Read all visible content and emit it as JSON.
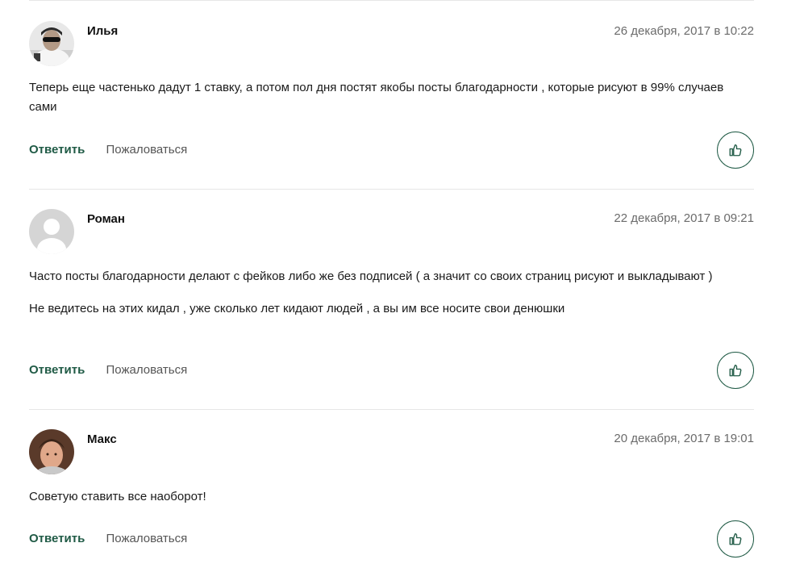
{
  "comments": [
    {
      "author": "Илья",
      "date": "26 декабря, 2017 в 10:22",
      "paragraphs": [
        "Теперь еще частенько дадут 1 ставку, а потом пол дня постят якобы посты благодарности , которые рисуют в 99% случаев сами"
      ],
      "reply_label": "Ответить",
      "report_label": "Пожаловаться",
      "avatar": "photo-sunglasses"
    },
    {
      "author": "Роман",
      "date": "22 декабря, 2017 в 09:21",
      "paragraphs": [
        "Часто посты благодарности делают с фейков либо же без подписей ( а значит со своих страниц рисуют и выкладывают )",
        "Не ведитесь на этих кидал , уже сколько лет кидают людей , а вы им все носите свои денюшки"
      ],
      "reply_label": "Ответить",
      "report_label": "Пожаловаться",
      "avatar": "default-user-placeholder"
    },
    {
      "author": "Макс",
      "date": "20 декабря, 2017 в 19:01",
      "paragraphs": [
        "Советую ставить все наоборот!"
      ],
      "reply_label": "Ответить",
      "report_label": "Пожаловаться",
      "avatar": "photo-face"
    }
  ],
  "colors": {
    "accent": "#1f5a45",
    "muted_text": "#6b6b6b",
    "divider": "#e6e6e6"
  },
  "icons": {
    "like": "thumbs-up-icon"
  }
}
